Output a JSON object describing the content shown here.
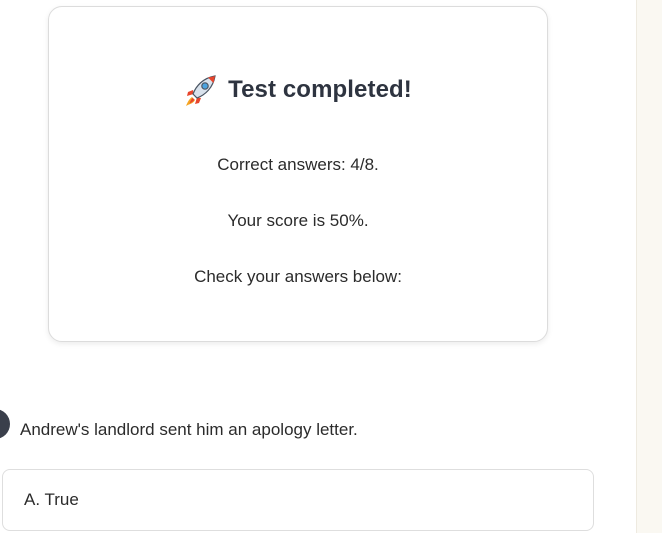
{
  "result": {
    "title": "Test completed!",
    "title_icon": "rocket-icon",
    "correct_answers": "Correct answers: 4/8.",
    "score": "Your score is 50%.",
    "check_prompt": "Check your answers below:"
  },
  "questions": [
    {
      "text": "Andrew's landlord sent him an apology letter.",
      "options": [
        {
          "label": "A. True"
        }
      ]
    }
  ],
  "colors": {
    "title_text": "#2e3440",
    "badge": "#3a3f4b",
    "card_border": "#dcdcdc",
    "gutter": "#faf8f2"
  }
}
